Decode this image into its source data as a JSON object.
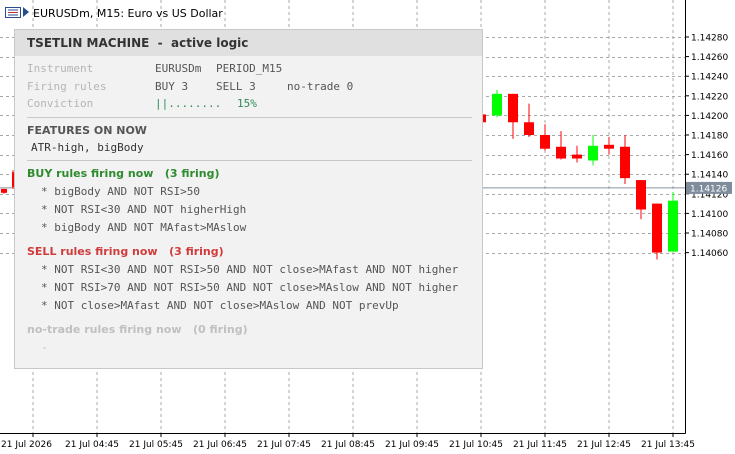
{
  "window": {
    "title": "EURUSDm, M15:  Euro vs US Dollar"
  },
  "axes": {
    "price_ticks": [
      "1.14280",
      "1.14260",
      "1.14240",
      "1.14220",
      "1.14200",
      "1.14180",
      "1.14160",
      "1.14140",
      "1.14120",
      "1.14100",
      "1.14080",
      "1.14060"
    ],
    "current_price": "1.14126",
    "time_ticks": [
      "21 Jul 2026",
      "21 Jul 04:45",
      "21 Jul 05:45",
      "21 Jul 06:45",
      "21 Jul 07:45",
      "21 Jul 08:45",
      "21 Jul 09:45",
      "21 Jul 10:45",
      "21 Jul 11:45",
      "21 Jul 12:45",
      "21 Jul 13:45"
    ]
  },
  "colors": {
    "bull": "#00ff00",
    "bear": "#ff0000",
    "buy_heading": "#2e8b2e",
    "sell_heading": "#d03c3c",
    "conviction": "#2e8b57",
    "price_tag": "#7f8c9c"
  },
  "panel": {
    "title": "TSETLIN MACHINE",
    "title_sep": "  -  ",
    "subtitle": "active logic",
    "instrument_label": "Instrument",
    "instrument_symbol": "EURUSDm",
    "instrument_period": "PERIOD_M15",
    "firing_label": "Firing rules",
    "firing_buy": "BUY 3",
    "firing_sell": "SELL 3",
    "firing_notrade": "no-trade 0",
    "conviction_label": "Conviction",
    "conviction_bar": "||........",
    "conviction_pct": "15%",
    "features_heading": "FEATURES ON NOW",
    "features_list": "ATR-high, bigBody",
    "buy_heading": "BUY rules firing now   (3 firing)",
    "buy_rules": [
      "* bigBody AND NOT RSI>50",
      "* NOT RSI<30 AND NOT higherHigh",
      "* bigBody AND NOT MAfast>MAslow"
    ],
    "sell_heading": "SELL rules firing now   (3 firing)",
    "sell_rules": [
      "* NOT RSI<30 AND NOT RSI>50 AND NOT close>MAfast AND NOT higher",
      "* NOT RSI>70 AND NOT RSI>50 AND NOT close>MAslow AND NOT higher",
      "* NOT close>MAfast AND NOT close>MAslow AND NOT prevUp"
    ],
    "notrade_heading": "no-trade rules firing now   (0 firing)",
    "notrade_rules": [
      "-"
    ]
  },
  "chart_data": {
    "type": "candlestick",
    "candles_visible": [
      {
        "o": 1.14201,
        "h": 1.1421,
        "l": 1.14193,
        "c": 1.14193
      },
      {
        "o": 1.142,
        "h": 1.14226,
        "l": 1.14198,
        "c": 1.14222
      },
      {
        "o": 1.14222,
        "h": 1.14222,
        "l": 1.14176,
        "c": 1.14193
      },
      {
        "o": 1.14193,
        "h": 1.14212,
        "l": 1.14178,
        "c": 1.1418
      },
      {
        "o": 1.1418,
        "h": 1.14191,
        "l": 1.14164,
        "c": 1.14166
      },
      {
        "o": 1.14168,
        "h": 1.14184,
        "l": 1.14155,
        "c": 1.14156
      },
      {
        "o": 1.1416,
        "h": 1.14169,
        "l": 1.14152,
        "c": 1.14156
      },
      {
        "o": 1.14154,
        "h": 1.1418,
        "l": 1.14149,
        "c": 1.14169
      },
      {
        "o": 1.1417,
        "h": 1.14178,
        "l": 1.1416,
        "c": 1.14166
      },
      {
        "o": 1.14168,
        "h": 1.1418,
        "l": 1.1413,
        "c": 1.14136
      },
      {
        "o": 1.14134,
        "h": 1.14134,
        "l": 1.14094,
        "c": 1.14104
      },
      {
        "o": 1.1411,
        "h": 1.1411,
        "l": 1.14053,
        "c": 1.1406
      },
      {
        "o": 1.14061,
        "h": 1.14122,
        "l": 1.14061,
        "c": 1.14113
      },
      {
        "o": 1.14113,
        "h": 1.1413,
        "l": 1.14113,
        "c": 1.14126
      }
    ],
    "left_edge_marks": [
      {
        "o": 1.14142,
        "h": 1.14144,
        "l": 1.14125,
        "c": 1.14127
      },
      {
        "o": 1.14125,
        "h": 1.14125,
        "l": 1.1412,
        "c": 1.14121
      }
    ]
  }
}
